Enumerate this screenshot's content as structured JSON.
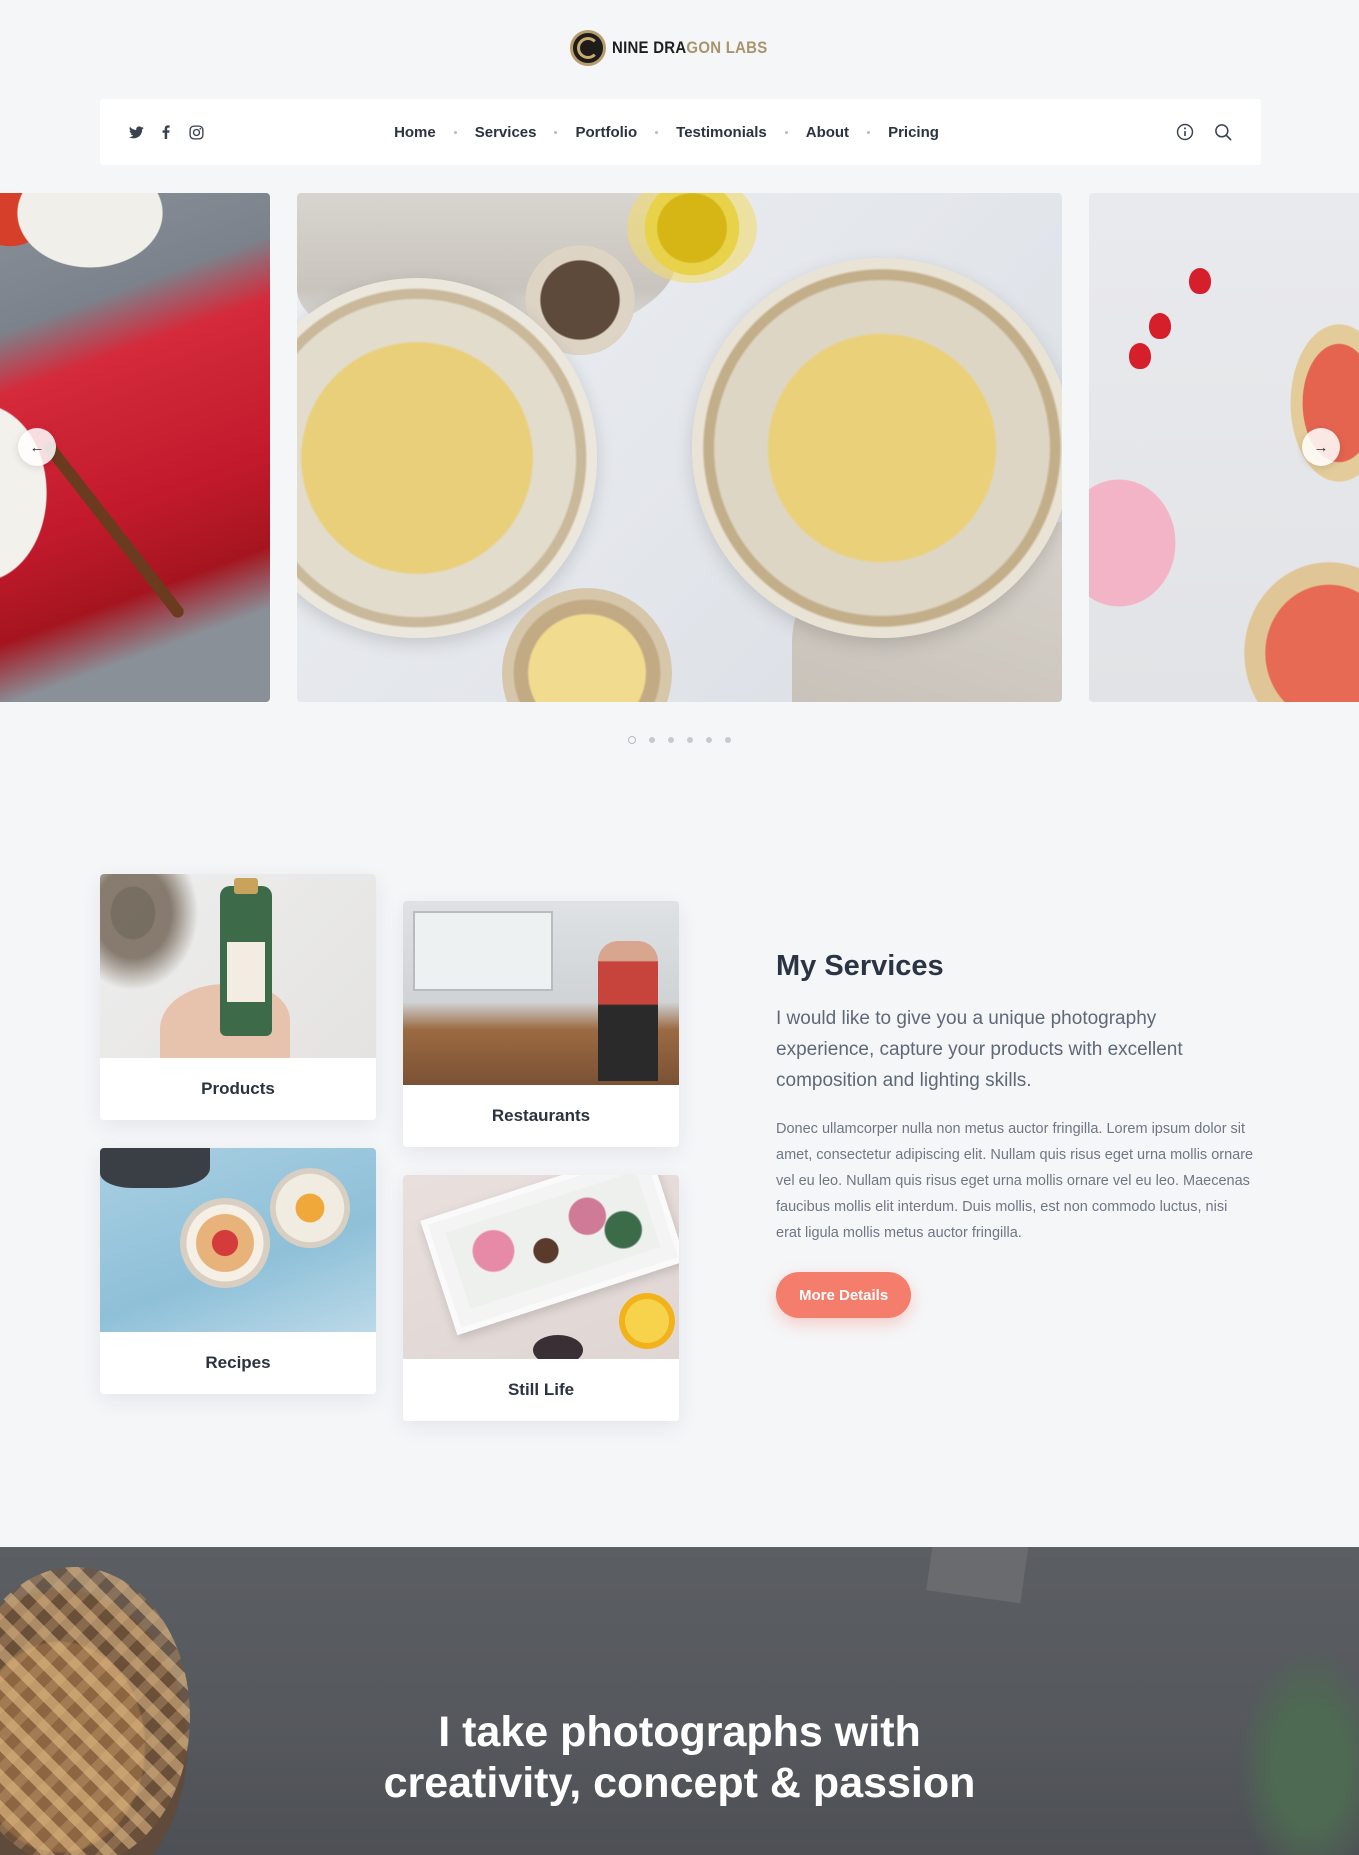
{
  "brand": {
    "name_part1": "NINE DRA",
    "name_part2": "GON LABS"
  },
  "social": {
    "twitter": "twitter-icon",
    "facebook": "facebook-icon",
    "instagram": "instagram-icon"
  },
  "nav": {
    "items": [
      {
        "label": "Home"
      },
      {
        "label": "Services"
      },
      {
        "label": "Portfolio"
      },
      {
        "label": "Testimonials"
      },
      {
        "label": "About"
      },
      {
        "label": "Pricing"
      }
    ],
    "info_icon": "info-icon",
    "search_icon": "search-icon"
  },
  "slider": {
    "slides": [
      "left-preview",
      "main",
      "right-preview"
    ],
    "dot_count": 6,
    "active_dot": 1
  },
  "services": {
    "cards": [
      {
        "label": "Products"
      },
      {
        "label": "Restaurants"
      },
      {
        "label": "Recipes"
      },
      {
        "label": "Still Life"
      }
    ],
    "title": "My Services",
    "lead": "I would like to give you a unique photography experience, capture your products with excellent composition and lighting skills.",
    "body": "Donec ullamcorper nulla non metus auctor fringilla. Lorem ipsum dolor sit amet, consectetur adipiscing elit. Nullam quis risus eget urna mollis ornare vel eu leo. Nullam quis risus eget urna mollis ornare vel eu leo. Maecenas faucibus mollis elit interdum. Duis mollis, est non commodo luctus, nisi erat ligula mollis metus auctor fringilla.",
    "button": "More Details",
    "accent": "#f47d6b"
  },
  "hero": {
    "line1": "I take photographs with",
    "line2": "creativity, concept & passion"
  }
}
